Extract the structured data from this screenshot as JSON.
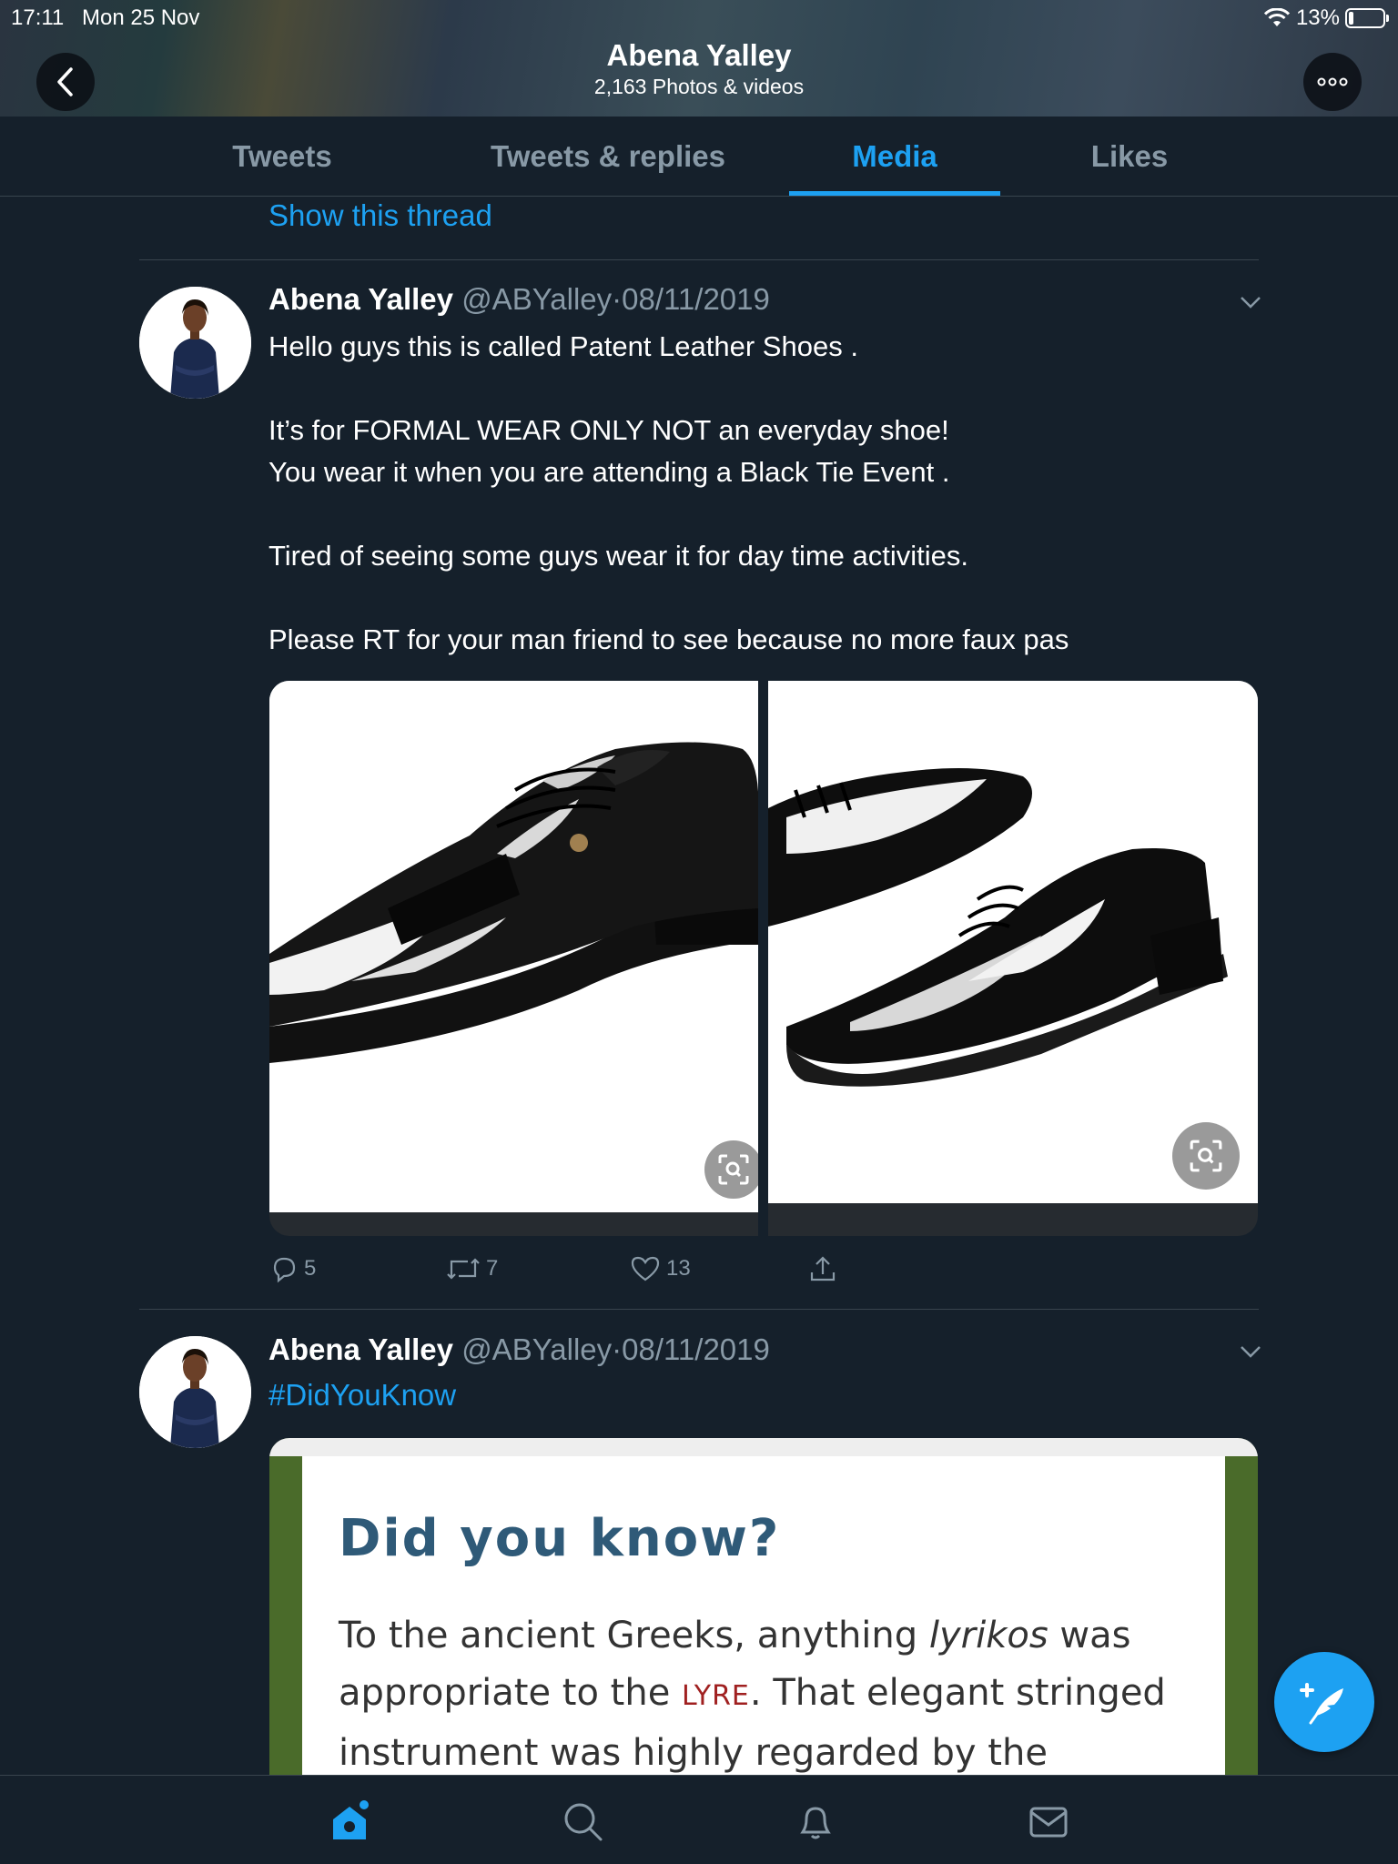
{
  "status_bar": {
    "time": "17:11",
    "date": "Mon 25 Nov",
    "battery": "13%"
  },
  "header": {
    "title": "Abena Yalley",
    "subtitle": "2,163 Photos & videos"
  },
  "tabs": [
    {
      "label": "Tweets",
      "active": false
    },
    {
      "label": "Tweets & replies",
      "active": false
    },
    {
      "label": "Media",
      "active": true
    },
    {
      "label": "Likes",
      "active": false
    }
  ],
  "thread_link": "Show this thread",
  "tweets": [
    {
      "name": "Abena Yalley",
      "handle": "@ABYalley",
      "separator": "·",
      "date": "08/11/2019",
      "body": "Hello guys this is called Patent Leather Shoes .\n\nIt’s for FORMAL WEAR ONLY NOT an everyday shoe!\nYou wear it when you are attending a Black Tie Event .\n\nTired of seeing some guys wear it for day time activities.\n\nPlease RT for your man friend to see because no more faux pas",
      "replies": "5",
      "retweets": "7",
      "likes": "13"
    },
    {
      "name": "Abena Yalley",
      "handle": "@ABYalley",
      "separator": "·",
      "date": "08/11/2019",
      "hashtag": "#DidYouKnow",
      "card": {
        "title": "Did you know?",
        "text_a": "To the ancient Greeks, anything ",
        "text_italic": "lyrikos",
        "text_b": " was appropriate to the ",
        "text_smallcaps": "LYRE",
        "text_c": ". That elegant stringed instrument was highly regarded by the"
      }
    }
  ],
  "colors": {
    "accent": "#1da1f2",
    "background": "#15202b",
    "muted": "#8899a6",
    "divider": "#38444d"
  }
}
